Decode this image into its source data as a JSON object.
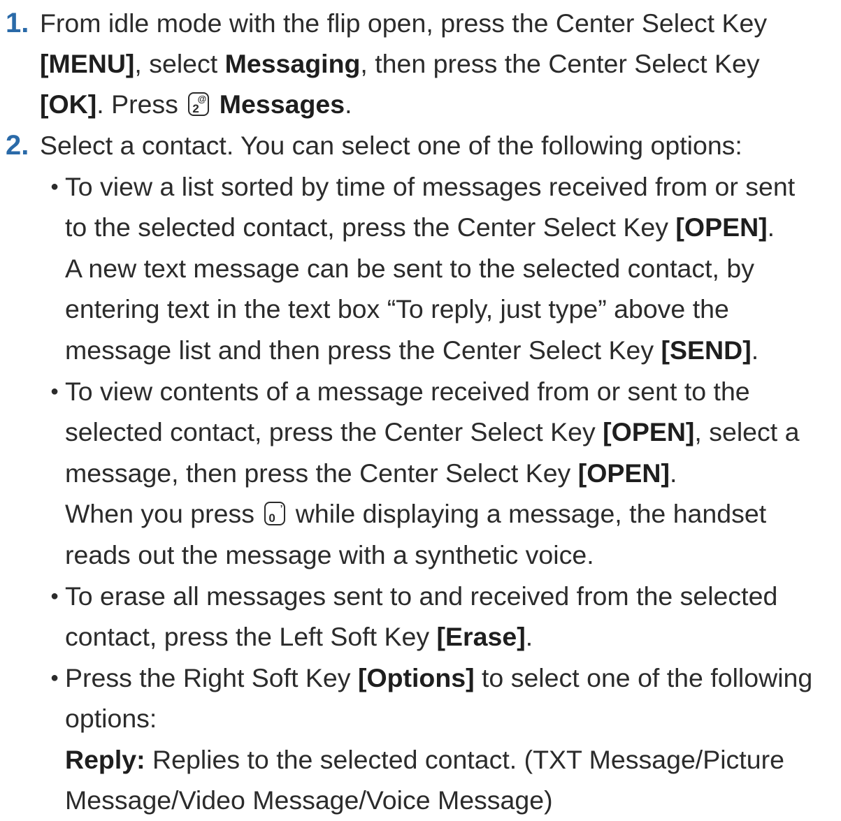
{
  "steps": [
    {
      "number": "1.",
      "lines": {
        "l1": "From idle mode with the flip open, press the Center Select Key",
        "l2_bold1": "[MENU]",
        "l2_t1": ", select ",
        "l2_bold2": "Messaging",
        "l2_t2": ", then press the Center Select Key",
        "l3_bold1": "[OK]",
        "l3_t1": ". Press ",
        "l3_key_main": "2",
        "l3_key_sup": "@",
        "l3_bold2": "Messages",
        "l3_t2": "."
      }
    },
    {
      "number": "2.",
      "intro": "Select a contact. You can select one of the following options:"
    }
  ],
  "bullets": {
    "b1": {
      "l1": "To view a list sorted by time of messages received from or sent",
      "l2_t1": "to the selected contact, press the Center Select Key ",
      "l2_bold": "[OPEN]",
      "l2_t2": ".",
      "l3": "A new text message can be sent to the selected contact, by",
      "l4": "entering text in the text box “To reply, just type” above the",
      "l5_t1": "message list and then press the Center Select Key ",
      "l5_bold": "[SEND]",
      "l5_t2": "."
    },
    "b2": {
      "l1": "To view contents of a message received from or sent to the",
      "l2_t1": "selected contact, press the Center Select Key ",
      "l2_bold": "[OPEN]",
      "l2_t2": ", select a",
      "l3_t1": "message, then press the Center Select Key ",
      "l3_bold": "[OPEN]",
      "l3_t2": ".",
      "l4_t1": "When you press ",
      "l4_key_main": "0",
      "l4_key_sup": "’",
      "l4_t2": " while displaying a message, the handset",
      "l5": "reads out the message with a synthetic voice."
    },
    "b3": {
      "l1": "To erase all messages sent to and received from the selected",
      "l2_t1": "contact, press the Left Soft Key ",
      "l2_bold": "[Erase]",
      "l2_t2": "."
    },
    "b4": {
      "l1_t1": "Press the Right Soft Key ",
      "l1_bold": "[Options]",
      "l1_t2": " to select one of the following",
      "l2": "options:",
      "l3_bold": "Reply:",
      "l3_t1": " Replies to the selected contact. (TXT Message/Picture",
      "l4": "Message/Video Message/Voice Message)"
    }
  },
  "bullet_glyph": "●",
  "colors": {
    "step_number": "#2a6aa8",
    "text": "#2b2b2b"
  }
}
